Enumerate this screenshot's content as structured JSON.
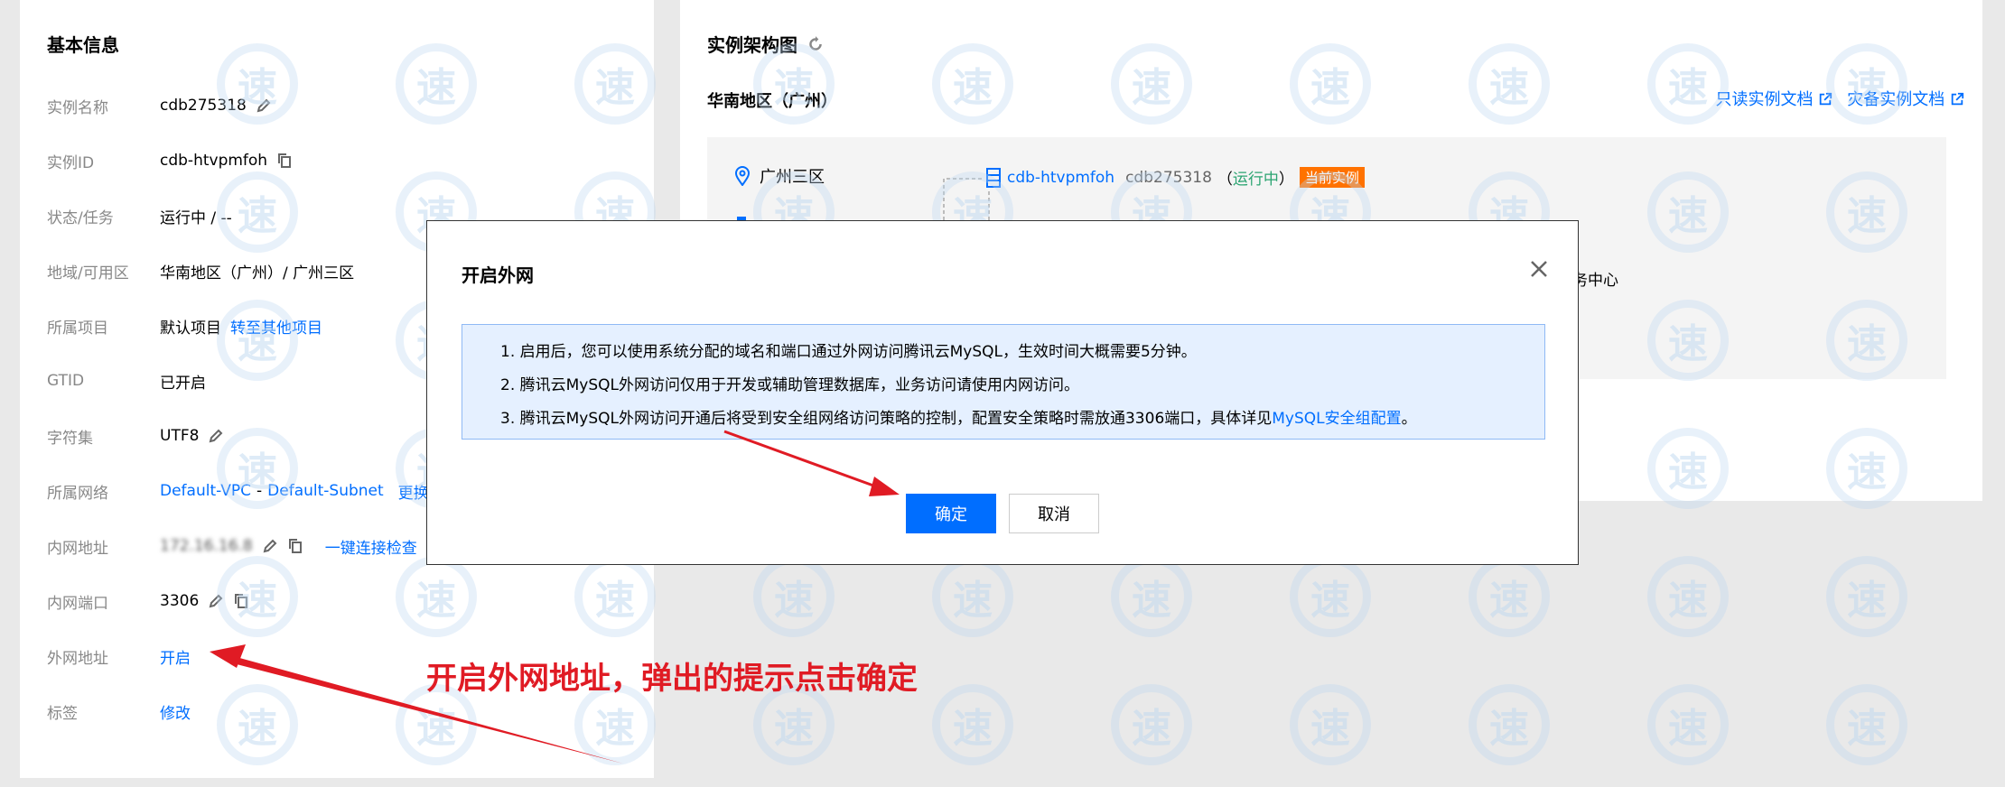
{
  "basic_info": {
    "title": "基本信息",
    "rows": [
      {
        "label": "实例名称",
        "value": "cdb275318"
      },
      {
        "label": "实例ID",
        "value": "cdb-htvpmfoh"
      },
      {
        "label": "状态/任务",
        "value": "运行中 / --"
      },
      {
        "label": "地域/可用区",
        "value": "华南地区（广州）/ 广州三区"
      },
      {
        "label": "所属项目",
        "value": "默认项目",
        "link": "转至其他项目"
      },
      {
        "label": "GTID",
        "value": "已开启"
      },
      {
        "label": "字符集",
        "value": "UTF8"
      },
      {
        "label": "所属网络",
        "vpc": "Default-VPC",
        "separator": "-",
        "subnet": "Default-Subnet",
        "link": "更换网"
      },
      {
        "label": "内网地址",
        "value": "172.16.16.8",
        "link": "一键连接检查"
      },
      {
        "label": "内网端口",
        "value": "3306"
      },
      {
        "label": "外网地址",
        "link": "开启"
      },
      {
        "label": "标签",
        "link": "修改"
      }
    ]
  },
  "architecture": {
    "title": "实例架构图",
    "region": "华南地区（广州）",
    "readonly_doc": "只读实例文档",
    "disaster_doc": "灾备实例文档",
    "zone": "广州三区",
    "instance_id": "cdb-htvpmfoh",
    "instance_name": "cdb275318",
    "paren_open": "（",
    "status": "运行中",
    "paren_close": "）",
    "current_badge": "当前实例",
    "partial_text": "务中心"
  },
  "dialog": {
    "title": "开启外网",
    "tips": [
      "1. 启用后，您可以使用系统分配的域名和端口通过外网访问腾讯云MySQL，生效时间大概需要5分钟。",
      "2. 腾讯云MySQL外网访问仅用于开发或辅助管理数据库，业务访问请使用内网访问。"
    ],
    "tip3_text": "3. 腾讯云MySQL外网访问开通后将受到安全组网络访问策略的控制，配置安全策略时需放通3306端口，具体详见",
    "tip3_link": "MySQL安全组配置",
    "tip3_end": "。",
    "confirm": "确定",
    "cancel": "取消"
  },
  "annotation": "开启外网地址，弹出的提示点击确定",
  "watermark_char": "速",
  "colors": {
    "link": "#006eff",
    "running": "#2ba471",
    "badge": "#ff7200",
    "annotation": "#e01b24"
  }
}
